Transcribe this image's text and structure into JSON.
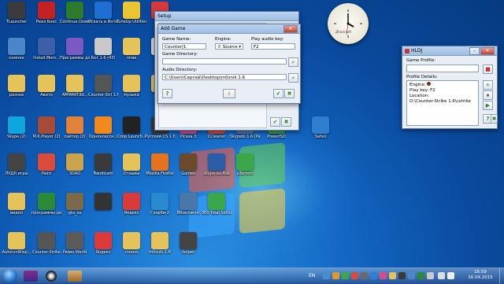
{
  "desktop": {
    "icons": [
      {
        "label": "TLauncher",
        "color": "#3b3b3b"
      },
      {
        "label": "Реал Бокс",
        "color": "#c42222"
      },
      {
        "label": "Continue Downloa...",
        "color": "#2d7a2d"
      },
      {
        "label": "Искать в Интернете",
        "color": "#1d6fd1"
      },
      {
        "label": "TuneUp Utilities 2014",
        "color": "#e8c531"
      },
      {
        "label": "",
        "color": "#d63a3a"
      },
      {
        "label": "компик",
        "color": "#4a86c8"
      },
      {
        "label": "Install.Mom...",
        "color": "#3d5ea8"
      },
      {
        "label": "Программы для Windows",
        "color": "#7a59c4"
      },
      {
        "label": "Бот 1.6 (43)",
        "color": "#c9c9c9"
      },
      {
        "label": "ппвв",
        "color": "#e6c25a"
      },
      {
        "label": "",
        "color": "#dddddd"
      },
      {
        "label": "разное",
        "color": "#e6c25a"
      },
      {
        "label": "Авито",
        "color": "#e6c25a"
      },
      {
        "label": "AMMAKTdd...",
        "color": "#e6c25a"
      },
      {
        "label": "Counter-Stri 1.6",
        "color": "#555555"
      },
      {
        "label": "музыка",
        "color": "#e6c25a"
      },
      {
        "label": "",
        "color": "#e6c25a"
      },
      {
        "label": "Skype (2)",
        "color": "#0fa6e0"
      },
      {
        "label": "M.K.Player (2)",
        "color": "#a64a3a"
      },
      {
        "label": "сайтер (2)",
        "color": "#e0823a"
      },
      {
        "label": "Одноклассн...",
        "color": "#f08a1d"
      },
      {
        "label": "Coop Launch...",
        "color": "#222222"
      },
      {
        "label": "Русский CS 1.6",
        "color": "#3a3a3a"
      },
      {
        "label": "Picasa 3",
        "color": "#d94b8f"
      },
      {
        "label": "CCleaner",
        "color": "#d94b3a"
      },
      {
        "label": "Skypebi 1.6 (Pac...)",
        "color": "#5577aa"
      },
      {
        "label": "PowerISO",
        "color": "#3a9a4a"
      },
      {
        "label": "Safari",
        "color": "#2e7fd0"
      },
      {
        "label": "ЛУДЛ игры",
        "color": "#444444"
      },
      {
        "label": "Paint",
        "color": "#d94b3a"
      },
      {
        "label": "3DAD",
        "color": "#c9a44a"
      },
      {
        "label": "Bandicam",
        "color": "#3a3a3a"
      },
      {
        "label": "Отзывы",
        "color": "#e6c25a"
      },
      {
        "label": "Mozilla Firefox",
        "color": "#e6731d"
      },
      {
        "label": "Games",
        "color": "#6a4a2a"
      },
      {
        "label": "skype-ax.Rus",
        "color": "#2b5ea8"
      },
      {
        "label": "µTorrent",
        "color": "#3aa84a"
      },
      {
        "label": "видео",
        "color": "#e6c25a"
      },
      {
        "label": "программы делинствия",
        "color": "#2a8a3a"
      },
      {
        "label": "gta_sa",
        "color": "#7a6a4a"
      },
      {
        "label": "",
        "color": "#333333"
      },
      {
        "label": "Яндекс",
        "color": "#d93a3a"
      },
      {
        "label": "Глорби-2",
        "color": "#2a8ad0"
      },
      {
        "label": "ВКонтакте",
        "color": "#4a76a8"
      },
      {
        "label": "360 Total Security",
        "color": "#3aa84a"
      },
      {
        "label": "AutorunWisp...",
        "color": "#e6c25a"
      },
      {
        "label": "Counter-Strike",
        "color": "#555555"
      },
      {
        "label": "Palwo World",
        "color": "#5a5a5a"
      },
      {
        "label": "Яндекс",
        "color": "#d93a3a"
      },
      {
        "label": "плиня",
        "color": "#e6c25a"
      },
      {
        "label": "m0snik 1.6",
        "color": "#e6c25a"
      },
      {
        "label": "Sniper",
        "color": "#444444"
      }
    ]
  },
  "bg_window": {
    "title": "Setup"
  },
  "add_game": {
    "title": "Add Game",
    "game_name_label": "Game Name:",
    "game_name_value": "Counter|1",
    "engine_label": "Engine:",
    "engine_value": "Source",
    "play_audio_label": "Play audio key:",
    "play_audio_value": "F2",
    "game_dir_label": "Game Directory:",
    "game_dir_value": "",
    "audio_dir_label": "Audio Directory:",
    "audio_dir_value": "C:\\Users\\Сергей\\Desktop\\m0snik 1.6"
  },
  "hldj": {
    "title": "HLDJ",
    "profile_label": "Game Profile:",
    "details_label": "Profile Details:",
    "engine_label": "Engine:",
    "playkey_label": "Play key:",
    "playkey_value": "F2",
    "location_label": "Location:",
    "location_value": "D:\\Counter-Strike 1.6\\cstrike"
  },
  "clock": {
    "brand": "Дhacksoft",
    "time_display": "16:59",
    "date_display": "16.04.2015"
  },
  "taskbar": {
    "language": "EN",
    "time": "16:59",
    "date": "16.04.2015"
  }
}
